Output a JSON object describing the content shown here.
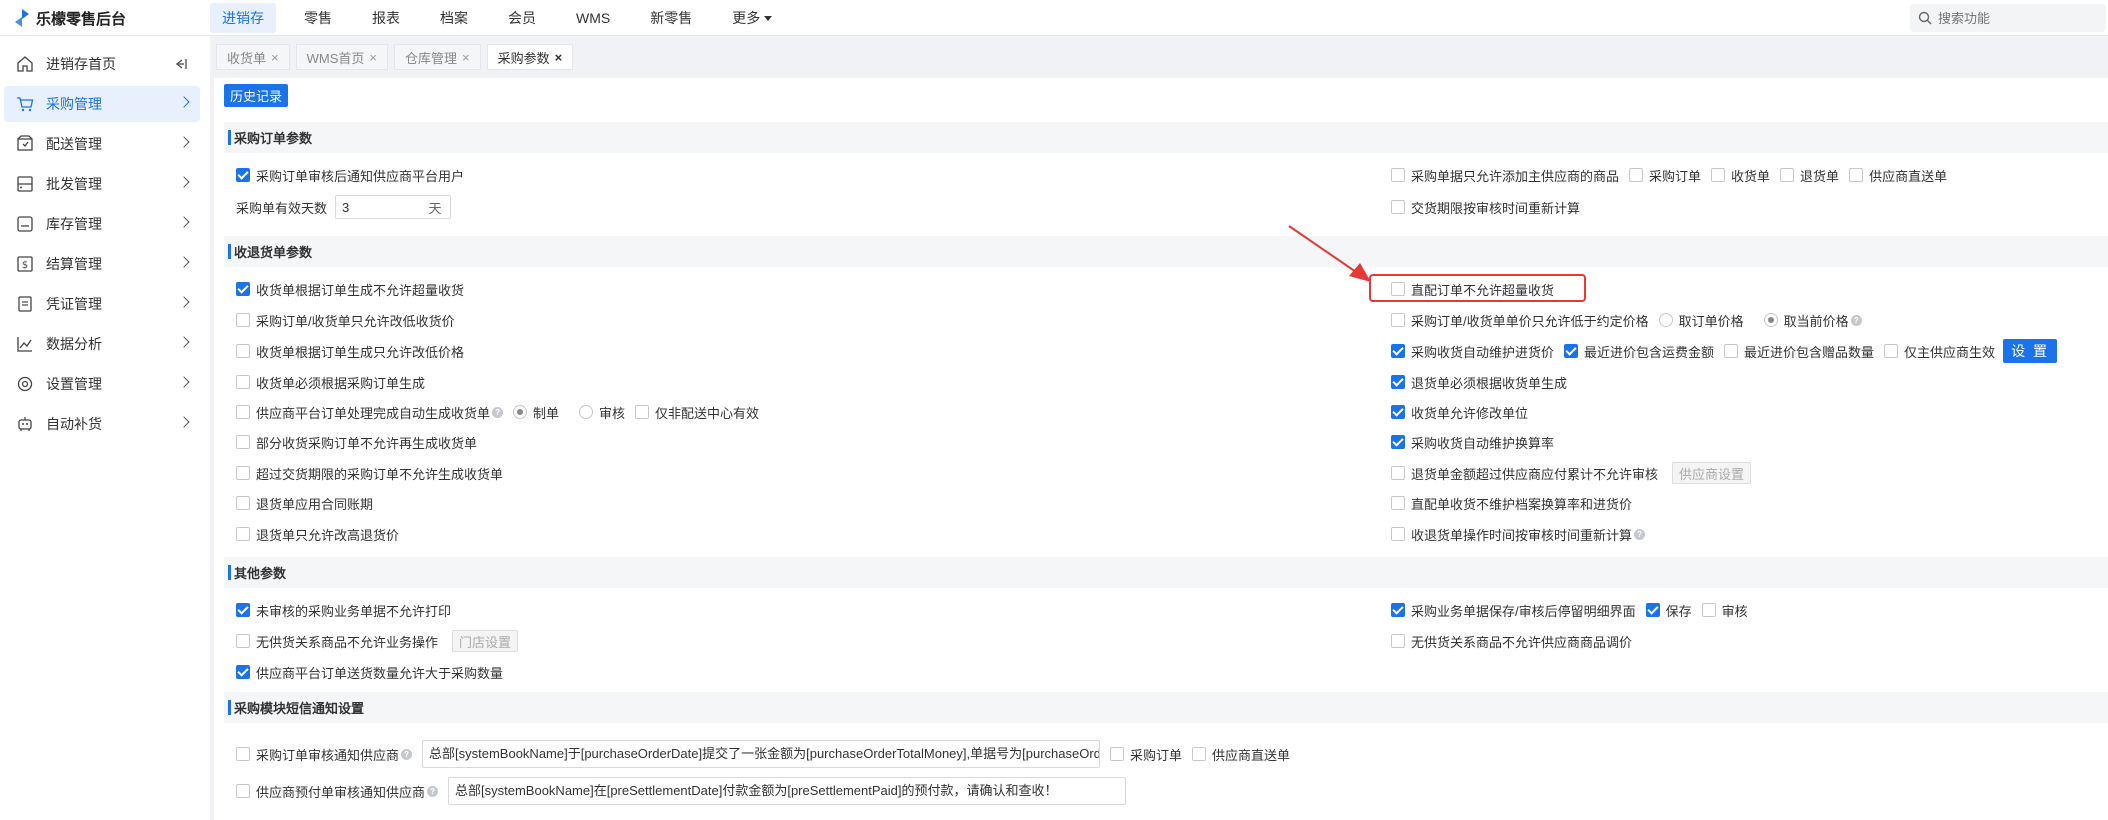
{
  "app": {
    "title": "乐檬零售后台"
  },
  "topnav": {
    "items": [
      "进销存",
      "零售",
      "报表",
      "档案",
      "会员",
      "WMS",
      "新零售",
      "更多"
    ],
    "search_placeholder": "搜索功能"
  },
  "sidebar": {
    "items": [
      "进销存首页",
      "采购管理",
      "配送管理",
      "批发管理",
      "库存管理",
      "结算管理",
      "凭证管理",
      "数据分析",
      "设置管理",
      "自动补货"
    ]
  },
  "tabs": [
    "收货单",
    "WMS首页",
    "仓库管理",
    "采购参数"
  ],
  "history_button": "历史记录",
  "sections": {
    "purchase_order": {
      "title": "采购订单参数",
      "notify_supplier": "采购订单审核后通知供应商平台用户",
      "valid_days_label": "采购单有效天数",
      "valid_days_value": "3",
      "valid_days_unit": "天",
      "main_supplier_only": "采购单据只允许添加主供应商的商品",
      "doc_purchase_order": "采购订单",
      "doc_receipt": "收货单",
      "doc_return": "退货单",
      "doc_supplier_direct": "供应商直送单",
      "delivery_recalc": "交货期限按审核时间重新计算"
    },
    "receipt_return": {
      "title": "收退货单参数",
      "left": [
        "收货单根据订单生成不允许超量收货",
        "采购订单/收货单只允许改低收货价",
        "收货单根据订单生成只允许改低价格",
        "收货单必须根据采购订单生成",
        "供应商平台订单处理完成自动生成收货单",
        "部分收货采购订单不允许再生成收货单",
        "超过交货期限的采购订单不允许生成收货单",
        "退货单应用合同账期",
        "退货单只允许改高退货价"
      ],
      "opt_make": "制单",
      "opt_audit": "审核",
      "opt_non_dc": "仅非配送中心有效",
      "right": [
        "直配订单不允许超量收货",
        "采购订单/收货单单价只允许低于约定价格",
        "采购收货自动维护进货价",
        "退货单必须根据收货单生成",
        "收货单允许修改单位",
        "采购收货自动维护换算率",
        "退货单金额超过供应商应付累计不允许审核",
        "直配单收货不维护档案换算率和进货价",
        "收退货单操作时间按审核时间重新计算"
      ],
      "opt_order_price": "取订单价格",
      "opt_current_price": "取当前价格",
      "opt_freight": "最近进价包含运费金额",
      "opt_gift": "最近进价包含赠品数量",
      "opt_main_supplier": "仅主供应商生效",
      "set_button": "设 置",
      "supplier_set_button": "供应商设置"
    },
    "other": {
      "title": "其他参数",
      "no_print_unaudited": "未审核的采购业务单据不允许打印",
      "no_supply_relation_op": "无供货关系商品不允许业务操作",
      "store_set_button": "门店设置",
      "platform_qty": "供应商平台订单送货数量允许大于采购数量",
      "stay_detail": "采购业务单据保存/审核后停留明细界面",
      "opt_save": "保存",
      "opt_audit": "审核",
      "no_supply_relation_price": "无供货关系商品不允许供应商商品调价"
    },
    "sms": {
      "title": "采购模块短信通知设置",
      "audit_notify": "采购订单审核通知供应商",
      "audit_template": "总部[systemBookName]于[purchaseOrderDate]提交了一张金额为[purchaseOrderTotalMoney],单据号为[purchaseOrderNo]的采购订单",
      "doc_purchase_order": "采购订单",
      "doc_supplier_direct": "供应商直送单",
      "prepay_notify": "供应商预付单审核通知供应商",
      "prepay_template": "总部[systemBookName]在[preSettlementDate]付款金额为[preSettlementPaid]的预付款，请确认和查收！"
    }
  },
  "colors": {
    "accent": "#1a73e8",
    "annotation": "#e53935"
  }
}
